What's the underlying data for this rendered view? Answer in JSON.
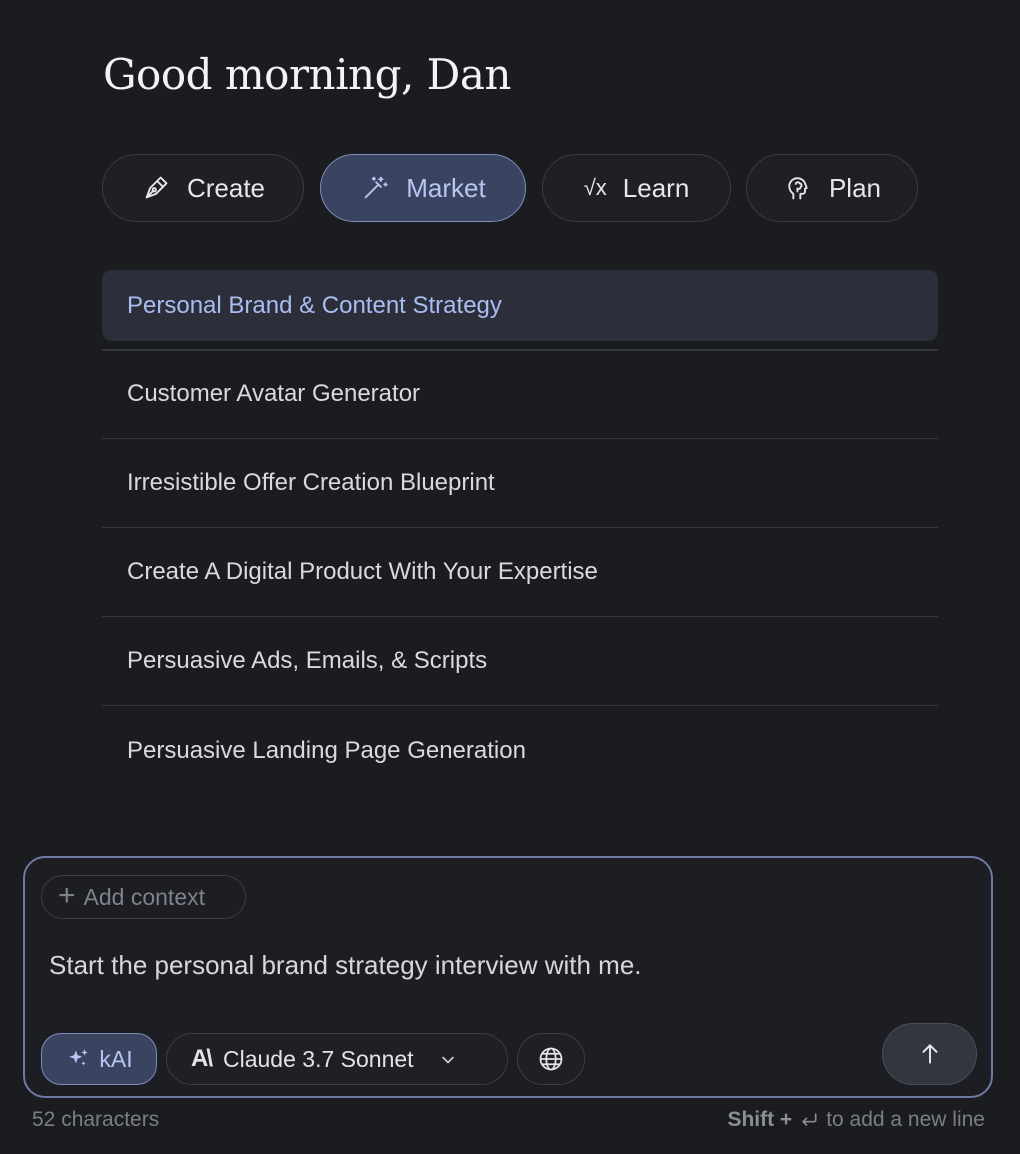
{
  "greeting": "Good morning, Dan",
  "tabs": [
    {
      "label": "Create",
      "icon": "pen-nib-icon"
    },
    {
      "label": "Market",
      "icon": "magic-wand-icon",
      "active": true
    },
    {
      "label": "Learn",
      "icon": "square-root-icon",
      "glyph": "√x"
    },
    {
      "label": "Plan",
      "icon": "head-brain-icon"
    }
  ],
  "list": {
    "items": [
      {
        "label": "Personal Brand & Content Strategy",
        "active": true
      },
      {
        "label": "Customer Avatar Generator"
      },
      {
        "label": "Irresistible Offer Creation Blueprint"
      },
      {
        "label": "Create A Digital Product With Your Expertise"
      },
      {
        "label": "Persuasive Ads, Emails, & Scripts"
      },
      {
        "label": "Persuasive Landing Page Generation"
      }
    ]
  },
  "composer": {
    "add_context_label": "Add context",
    "input_value": "Start the personal brand strategy interview with me.",
    "kai_label": "kAI",
    "model_logo": "A\\",
    "model_name": "Claude 3.7 Sonnet"
  },
  "footer": {
    "char_count": "52 characters",
    "hint_key": "Shift +",
    "hint_text": "to add a new line"
  },
  "colors": {
    "background": "#1b1c20",
    "accent": "#b8c6f2",
    "accent_bg": "#3a4460",
    "active_item_text": "#a9bdf3"
  }
}
